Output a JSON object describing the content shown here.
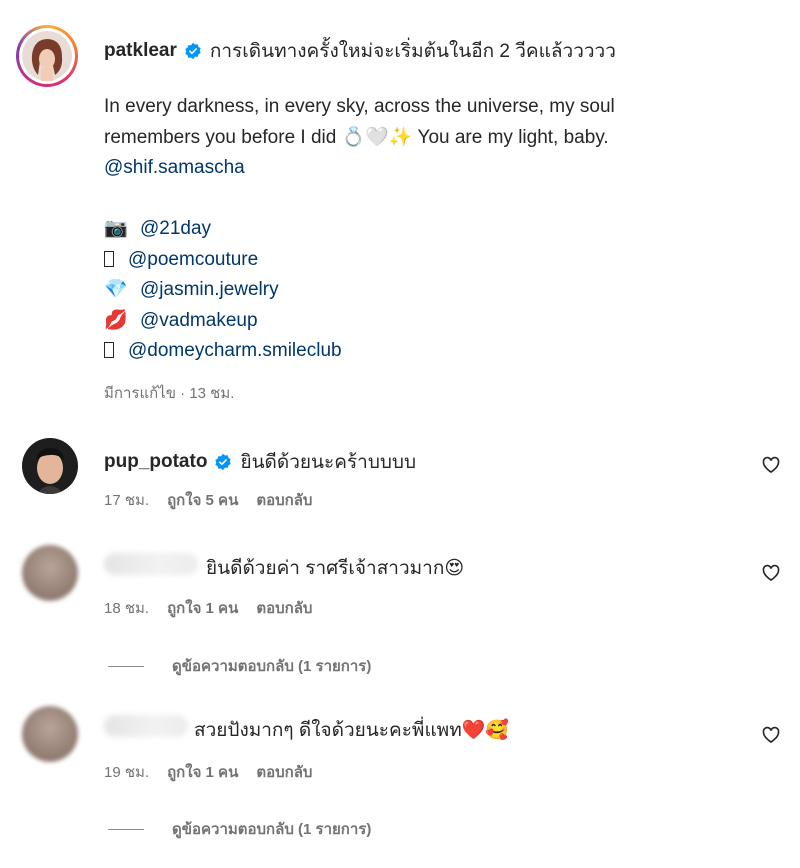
{
  "post": {
    "username": "patklear",
    "caption_first": "การเดินทางครั้งใหม่จะเริ่มต้นในอีก 2 วีคแล้ววววว",
    "caption_line2": "In every darkness, in every sky, across the universe, my soul",
    "caption_line3": "remembers you before I did 💍🤍✨ You are my light, baby.",
    "mention_main": "@shif.samascha",
    "credits": [
      {
        "icon": "📷",
        "handle": "@21day"
      },
      {
        "icon": "▯",
        "handle": "@poemcouture"
      },
      {
        "icon": "💎",
        "handle": "@jasmin.jewelry"
      },
      {
        "icon": "💋",
        "handle": "@vadmakeup"
      },
      {
        "icon": "▯",
        "handle": "@domeycharm.smileclub"
      }
    ],
    "meta": "มีการแก้ไข · 13 ชม."
  },
  "comments": [
    {
      "username": "pup_potato",
      "text": "ยินดีด้วยนะคร้าบบบบ",
      "time": "17 ชม.",
      "likes": "ถูกใจ 5 คน",
      "reply": "ตอบกลับ"
    },
    {
      "username": "",
      "text": "ยินดีด้วยค่า ราศรีเจ้าสาวมาก😍",
      "time": "18 ชม.",
      "likes": "ถูกใจ 1 คน",
      "reply": "ตอบกลับ",
      "view_replies": "ดูข้อความตอบกลับ (1 รายการ)"
    },
    {
      "username": "",
      "text": "สวยปังมากๆ ดีใจด้วยนะคะพี่แพท❤️🥰",
      "time": "19 ชม.",
      "likes": "ถูกใจ 1 คน",
      "reply": "ตอบกลับ",
      "view_replies": "ดูข้อความตอบกลับ (1 รายการ)"
    }
  ],
  "icons": {
    "verified": "verified-badge-icon",
    "heart": "heart-icon"
  },
  "colors": {
    "mention": "#00376b",
    "verified": "#0095f6",
    "muted": "#737373"
  }
}
